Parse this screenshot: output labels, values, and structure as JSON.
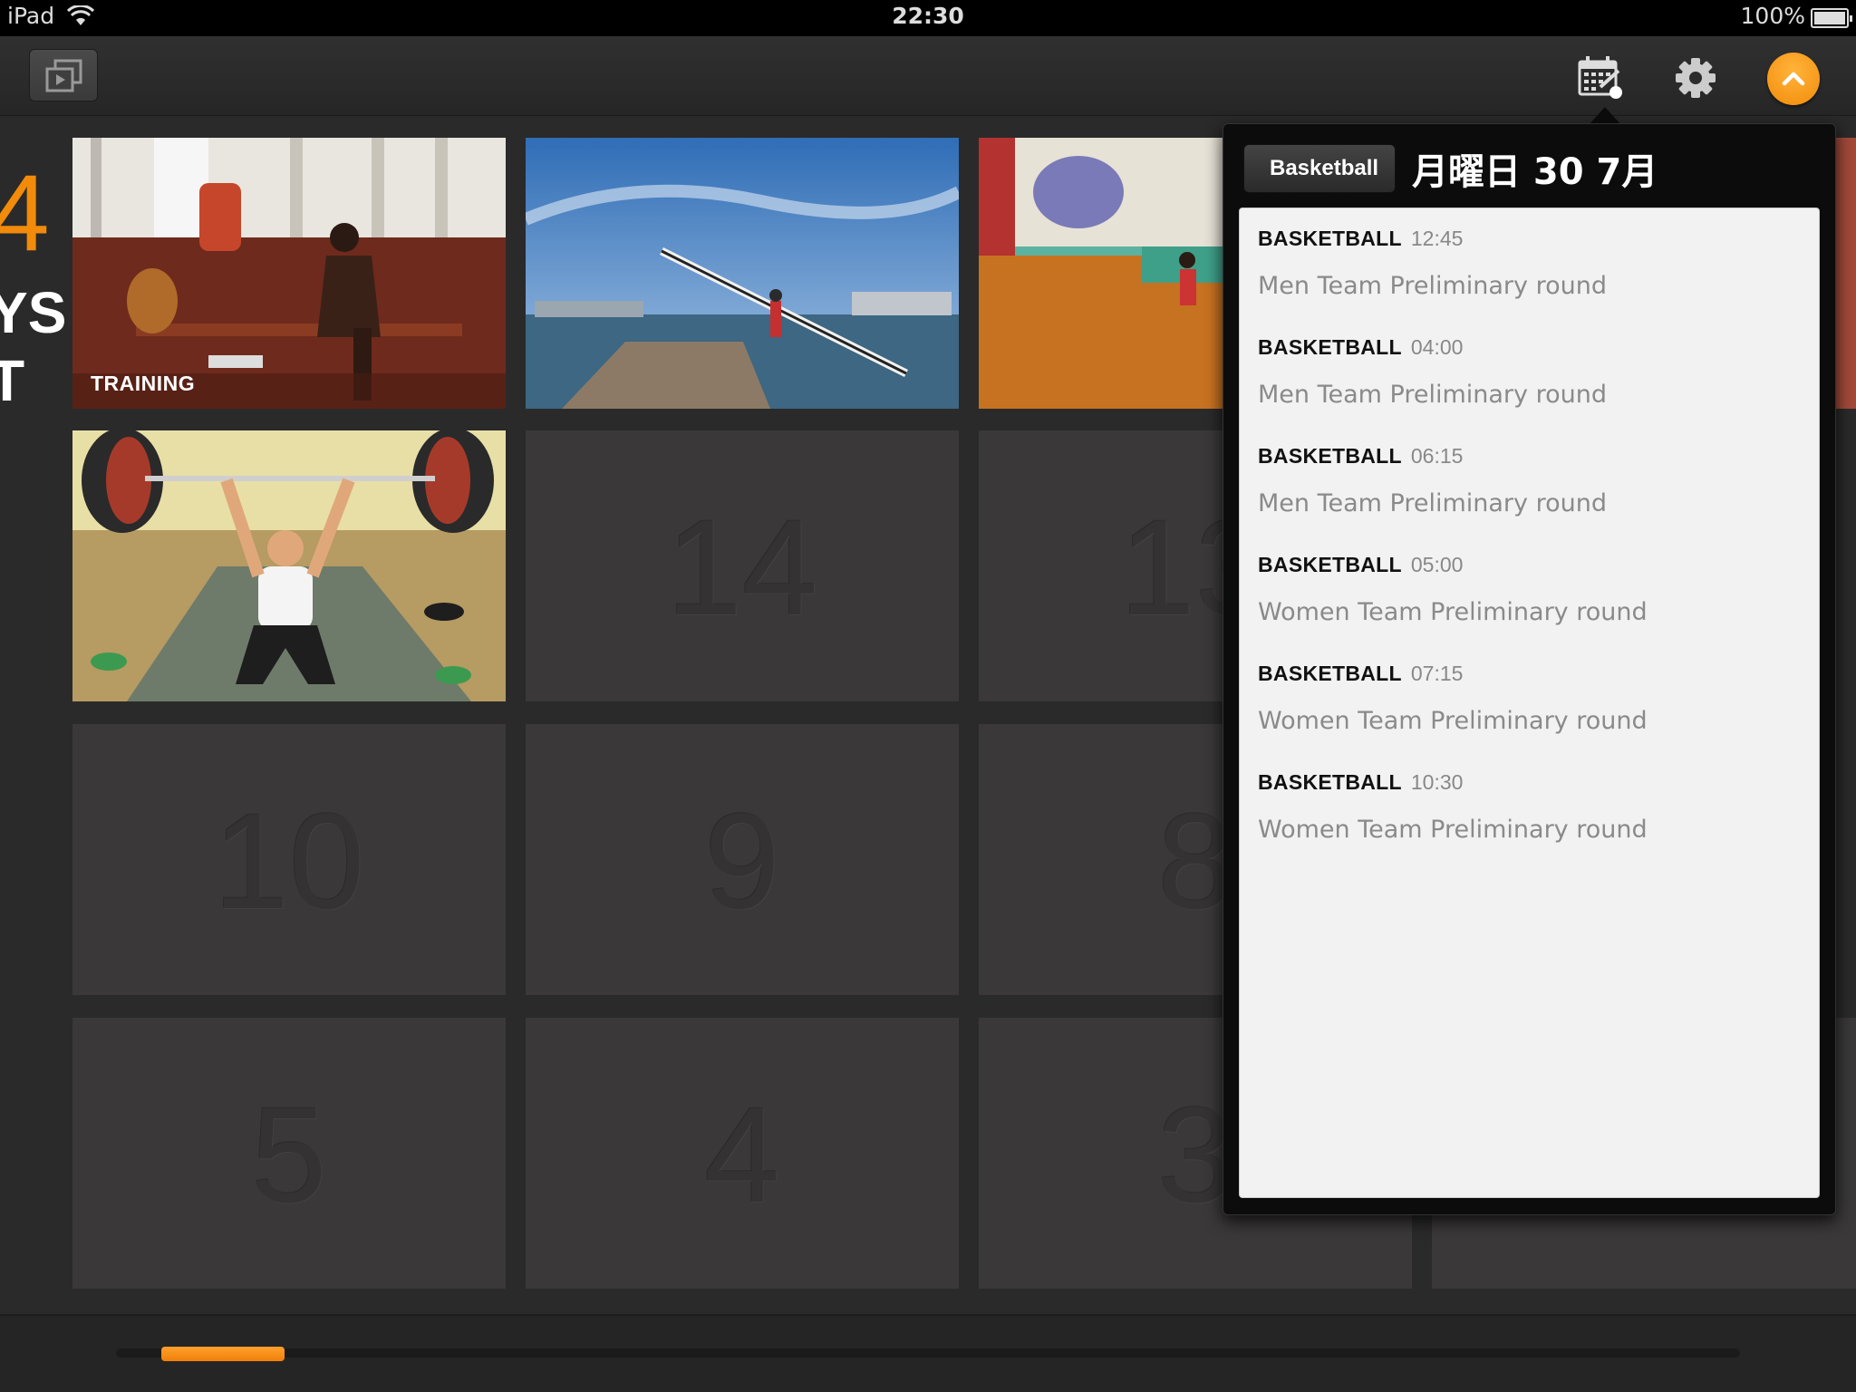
{
  "status_bar": {
    "device": "iPad",
    "time": "22:30",
    "battery": "100%"
  },
  "header_partial": {
    "number": "4",
    "line1": "YS",
    "line2": "T"
  },
  "tiles": [
    {
      "caption": "TRAINING"
    },
    {
      "number": "14"
    },
    {
      "number": "13"
    },
    {
      "number": "10"
    },
    {
      "number": "9"
    },
    {
      "number": "8"
    },
    {
      "number": "5"
    },
    {
      "number": "4"
    },
    {
      "number": "3"
    }
  ],
  "popover": {
    "back_label": "Basketball",
    "title": "月曜日 30 7月",
    "events": [
      {
        "sport": "BASKETBALL",
        "time": "12:45",
        "desc": "Men Team Preliminary round"
      },
      {
        "sport": "BASKETBALL",
        "time": "04:00",
        "desc": "Men Team Preliminary round"
      },
      {
        "sport": "BASKETBALL",
        "time": "06:15",
        "desc": "Men Team Preliminary round"
      },
      {
        "sport": "BASKETBALL",
        "time": "05:00",
        "desc": "Women Team Preliminary round"
      },
      {
        "sport": "BASKETBALL",
        "time": "07:15",
        "desc": "Women Team Preliminary round"
      },
      {
        "sport": "BASKETBALL",
        "time": "10:30",
        "desc": "Women Team Preliminary round"
      }
    ]
  },
  "icons": {
    "media": "media-gallery-icon",
    "calendar": "calendar-icon",
    "settings": "gear-icon",
    "up": "chevron-up-icon",
    "wifi": "wifi-icon",
    "battery": "battery-icon"
  },
  "colors": {
    "accent": "#f28b0a",
    "background": "#2a2a2a",
    "tile": "#3a3838",
    "list_bg": "#f2f2f2"
  },
  "scrubber": {
    "position": 0.04
  }
}
